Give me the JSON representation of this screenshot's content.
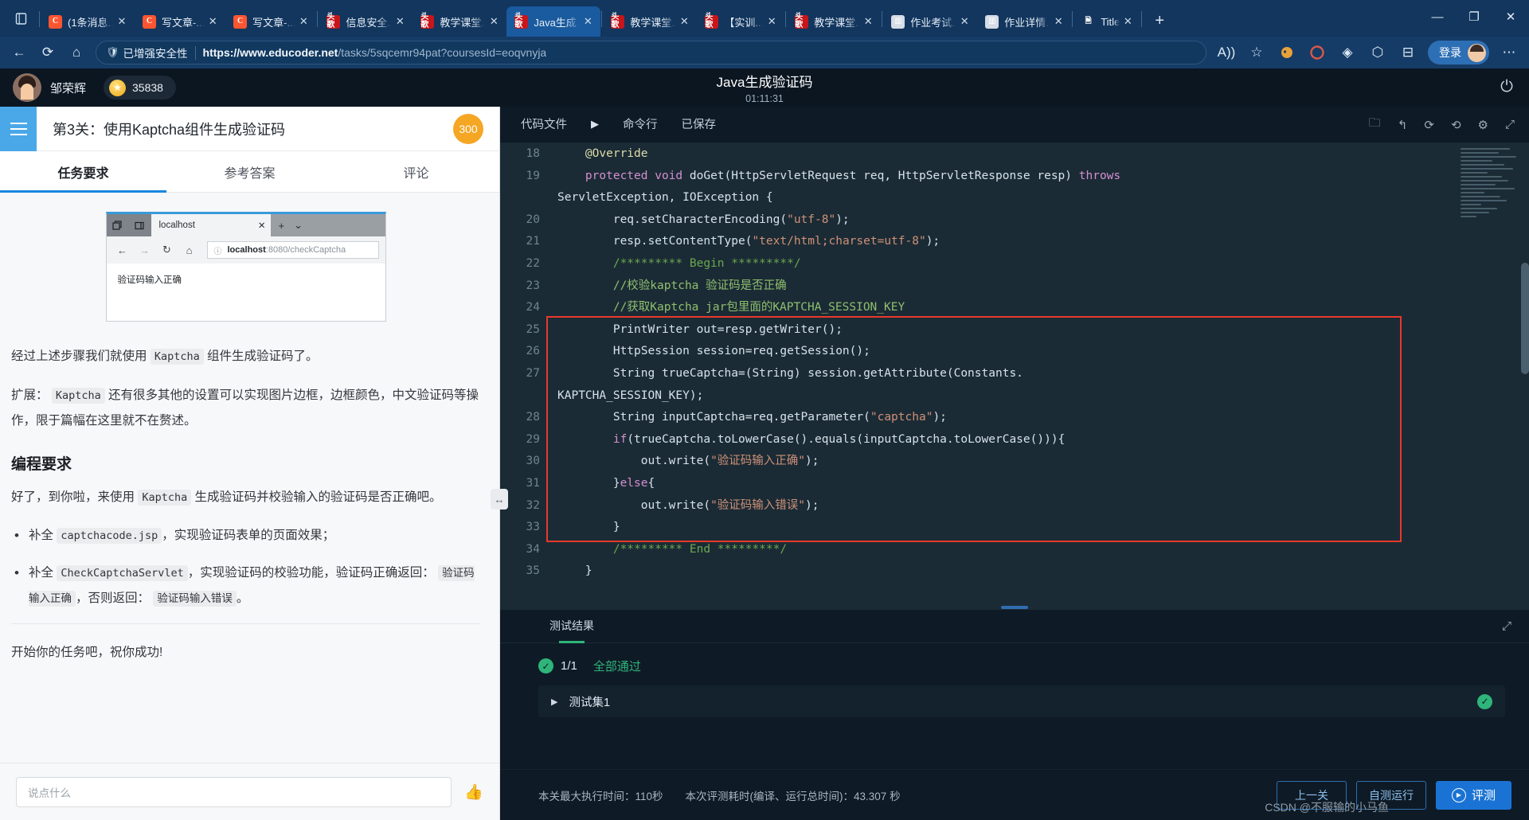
{
  "browser": {
    "tabs": [
      {
        "title": "(1条消息...",
        "icon": "csdn-icon",
        "type": "csdn",
        "active": false
      },
      {
        "title": "写文章-...",
        "icon": "csdn-icon",
        "type": "csdn",
        "active": false
      },
      {
        "title": "写文章-...",
        "icon": "csdn-icon",
        "type": "csdn",
        "active": false
      },
      {
        "title": "信息安全...",
        "icon": "touge-icon",
        "type": "touge",
        "active": false
      },
      {
        "title": "教学课堂...",
        "icon": "touge-icon",
        "type": "touge",
        "active": false
      },
      {
        "title": "Java生成...",
        "icon": "touge-icon",
        "type": "touge",
        "active": true
      },
      {
        "title": "教学课堂...",
        "icon": "touge-icon",
        "type": "touge",
        "active": false
      },
      {
        "title": "【实训...",
        "icon": "touge-icon",
        "type": "touge",
        "active": false
      },
      {
        "title": "教学课堂...",
        "icon": "touge-icon",
        "type": "touge",
        "active": false
      },
      {
        "title": "作业考试...",
        "icon": "chart-icon",
        "type": "chart",
        "active": false
      },
      {
        "title": "作业详情...",
        "icon": "chart-icon",
        "type": "chart",
        "active": false
      },
      {
        "title": "Title",
        "icon": "document-icon",
        "type": "doc",
        "active": false
      }
    ],
    "close_label": "✕",
    "newtab_label": "+",
    "window": {
      "minimize": "—",
      "maximize": "❐",
      "close": "✕"
    },
    "nav": {
      "back": "←",
      "reload": "⟳",
      "home": "⌂"
    },
    "omnibox": {
      "security_label": "已增强安全性",
      "url_host": "https://www.educoder.net",
      "url_path": "/tasks/5sqcemr94pat?coursesId=eoqvnyja"
    },
    "toolbar_right": {
      "read_aloud": "A))",
      "favorite": "☆",
      "collections": "◈",
      "extensions": "⬡",
      "split": "⊟",
      "login_label": "登录",
      "more": "⋯"
    }
  },
  "app_header": {
    "user_name": "邹荣辉",
    "coin_value": "35838",
    "coin_icon": "star-icon",
    "title": "Java生成验证码",
    "timer": "01:11:31",
    "power_icon": "power-icon"
  },
  "left": {
    "mission_title": "第3关：使用Kaptcha组件生成验证码",
    "score_badge": "300",
    "tabs": [
      {
        "label": "任务要求",
        "active": true
      },
      {
        "label": "参考答案",
        "active": false
      },
      {
        "label": "评论",
        "active": false
      }
    ],
    "screenshot": {
      "tab_label": "localhost",
      "tab_close": "✕",
      "plus": "+",
      "chevron": "⌄",
      "nav_back": "←",
      "nav_fwd": "→",
      "nav_reload": "↻",
      "nav_home": "⌂",
      "info_icon": "ⓘ",
      "url_host": "localhost",
      "url_rest": ":8080/checkCaptcha",
      "body_text": "验证码输入正确"
    },
    "para1_a": "经过上述步骤我们就使用 ",
    "para1_code": "Kaptcha",
    "para1_b": " 组件生成验证码了。",
    "para2_a": "扩展：",
    "para2_code": "Kaptcha",
    "para2_b": "还有很多其他的设置可以实现图片边框，边框颜色，中文验证码等操作，限于篇幅在这里就不在赘述。",
    "heading": "编程要求",
    "para3_a": "好了，到你啦，来使用 ",
    "para3_code": "Kaptcha",
    "para3_b": " 生成验证码并校验输入的验证码是否正确吧。",
    "bullets": [
      {
        "pre": "补全 ",
        "code": "captchacode.jsp",
        "post": "，实现验证码表单的页面效果；"
      }
    ],
    "bullet2": {
      "pre": "补全 ",
      "code": "CheckCaptchaServlet",
      "mid": "，实现验证码的校验功能，验证码正确返回：",
      "code2": "验证码输入正确",
      "mid2": "，否则返回：",
      "code3": "验证码输入错误",
      "post": "。"
    },
    "closing": "开始你的任务吧，祝你成功!",
    "comment_placeholder": "说点什么",
    "thumb_icon": "thumbs-up-icon",
    "splitter_icon": "↔"
  },
  "editor": {
    "toolbar": {
      "files": "代码文件",
      "run_icon": "▶",
      "command_line": "命令行",
      "saved": "已保存",
      "icons": [
        "folder-icon",
        "undo-icon",
        "redo-icon",
        "refresh-icon",
        "gear-icon",
        "expand-icon"
      ]
    },
    "lines": [
      {
        "n": "18",
        "tokens": [
          {
            "t": "    ",
            "c": "fn"
          },
          {
            "t": "@Override",
            "c": "ann"
          }
        ]
      },
      {
        "n": "19",
        "tokens": [
          {
            "t": "    ",
            "c": "fn"
          },
          {
            "t": "protected",
            "c": "kw"
          },
          {
            "t": " ",
            "c": "fn"
          },
          {
            "t": "void",
            "c": "kw"
          },
          {
            "t": " doGet(HttpServletRequest req, HttpServletResponse resp) ",
            "c": "fn"
          },
          {
            "t": "throws",
            "c": "kw"
          },
          {
            "t": "\nServletException, IOException {",
            "c": "fn"
          }
        ]
      },
      {
        "n": "20",
        "tokens": [
          {
            "t": "        req.setCharacterEncoding(",
            "c": "fn"
          },
          {
            "t": "\"utf-8\"",
            "c": "str"
          },
          {
            "t": ");",
            "c": "fn"
          }
        ]
      },
      {
        "n": "21",
        "tokens": [
          {
            "t": "        resp.setContentType(",
            "c": "fn"
          },
          {
            "t": "\"text/html;charset=utf-8\"",
            "c": "str"
          },
          {
            "t": ");",
            "c": "fn"
          }
        ]
      },
      {
        "n": "22",
        "tokens": [
          {
            "t": "        /********* Begin *********/",
            "c": "cmt"
          }
        ]
      },
      {
        "n": "23",
        "tokens": [
          {
            "t": "        //校验kaptcha 验证码是否正确",
            "c": "cmt2"
          }
        ]
      },
      {
        "n": "24",
        "tokens": [
          {
            "t": "        //获取Kaptcha jar包里面的KAPTCHA_SESSION_KEY",
            "c": "cmt2"
          }
        ]
      },
      {
        "n": "25",
        "tokens": [
          {
            "t": "        PrintWriter out=resp.getWriter();",
            "c": "fn"
          }
        ]
      },
      {
        "n": "26",
        "tokens": [
          {
            "t": "        HttpSession session=req.getSession();",
            "c": "fn"
          }
        ]
      },
      {
        "n": "27",
        "tokens": [
          {
            "t": "        String trueCaptcha=(String) session.getAttribute(Constants.\nKAPTCHA_SESSION_KEY);",
            "c": "fn"
          }
        ]
      },
      {
        "n": "28",
        "tokens": [
          {
            "t": "        String inputCaptcha=req.getParameter(",
            "c": "fn"
          },
          {
            "t": "\"captcha\"",
            "c": "str"
          },
          {
            "t": ");",
            "c": "fn"
          }
        ]
      },
      {
        "n": "29",
        "tokens": [
          {
            "t": "        ",
            "c": "fn"
          },
          {
            "t": "if",
            "c": "kw"
          },
          {
            "t": "(trueCaptcha.toLowerCase().equals(inputCaptcha.toLowerCase())){",
            "c": "fn"
          }
        ]
      },
      {
        "n": "30",
        "tokens": [
          {
            "t": "            out.write(",
            "c": "fn"
          },
          {
            "t": "\"验证码输入正确\"",
            "c": "str"
          },
          {
            "t": ");",
            "c": "fn"
          }
        ]
      },
      {
        "n": "31",
        "tokens": [
          {
            "t": "        }",
            "c": "fn"
          },
          {
            "t": "else",
            "c": "kw"
          },
          {
            "t": "{",
            "c": "fn"
          }
        ]
      },
      {
        "n": "32",
        "tokens": [
          {
            "t": "            out.write(",
            "c": "fn"
          },
          {
            "t": "\"验证码输入错误\"",
            "c": "str"
          },
          {
            "t": ");",
            "c": "fn"
          }
        ]
      },
      {
        "n": "33",
        "tokens": [
          {
            "t": "        }",
            "c": "fn"
          }
        ]
      },
      {
        "n": "34",
        "tokens": [
          {
            "t": "        /********* End *********/",
            "c": "cmt"
          }
        ]
      },
      {
        "n": "35",
        "tokens": [
          {
            "t": "    }",
            "c": "fn"
          }
        ]
      }
    ],
    "highlight_color": "#e8392a"
  },
  "result": {
    "tab_label": "测试结果",
    "expand_icon": "expand-icon",
    "check_icon": "✓",
    "fraction": "1/1",
    "pass_label": "全部通过",
    "rows": [
      {
        "caret": "▶",
        "name": "测试集1",
        "status": "✓"
      }
    ]
  },
  "footer": {
    "limit_text": "本关最大执行时间：110秒",
    "elapsed_text": "本次评测耗时(编译、运行总时间)：43.307 秒",
    "prev_btn": "上一关",
    "selftest_btn": "自测运行",
    "evaluate_btn": "评测",
    "evaluate_icon": "play-icon",
    "watermark": "CSDN @不服输的小马鱼"
  }
}
